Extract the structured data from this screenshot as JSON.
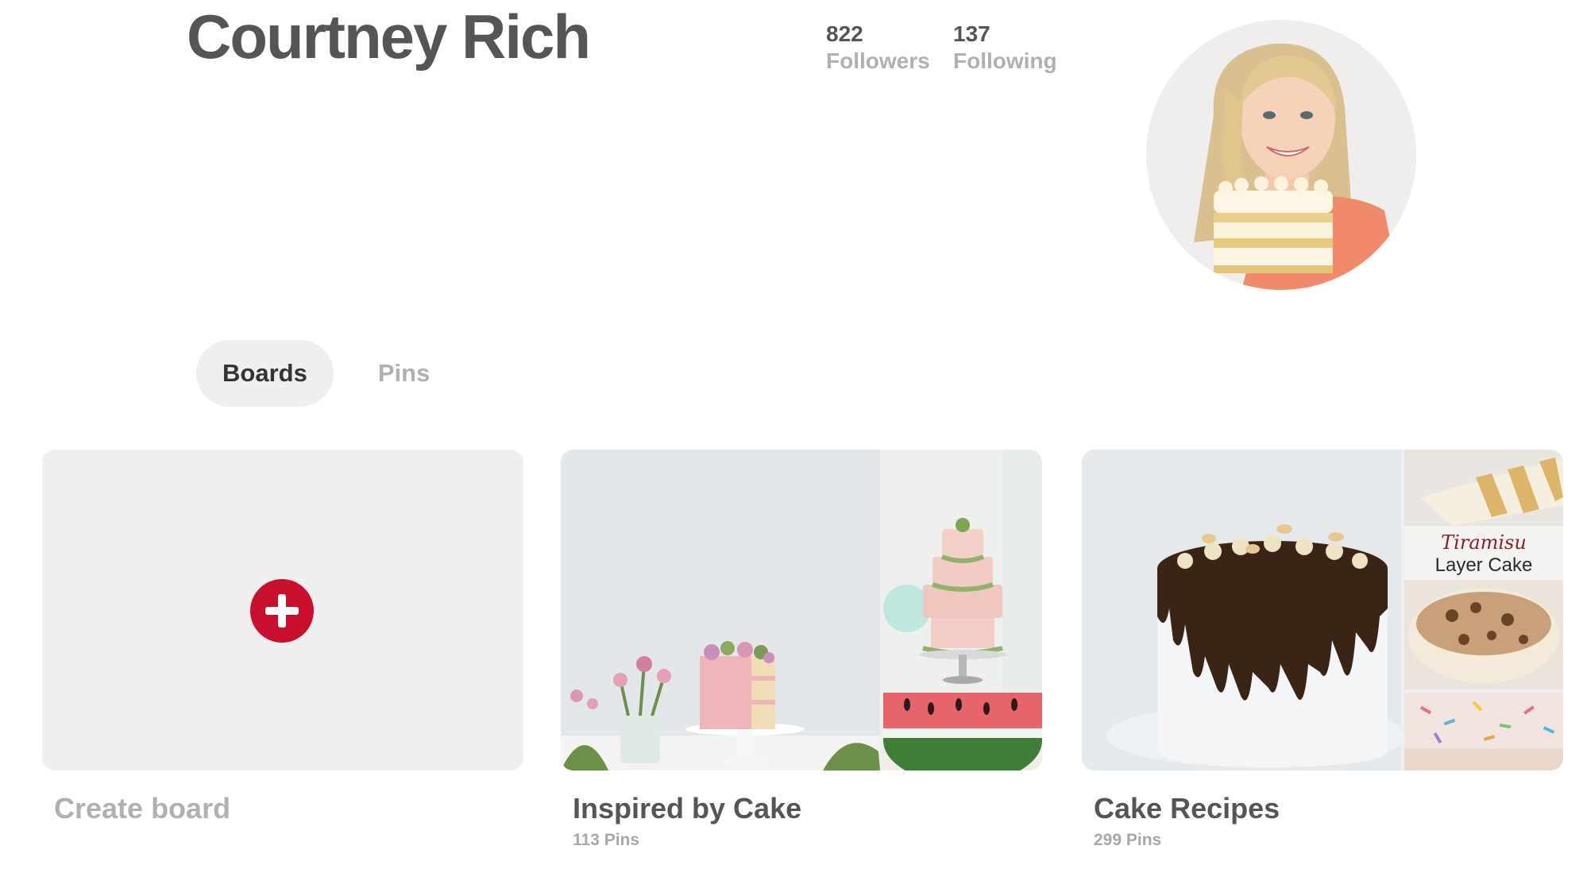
{
  "profile": {
    "name": "Courtney Rich",
    "followers_count": "822",
    "followers_label": "Followers",
    "following_count": "137",
    "following_label": "Following"
  },
  "tabs": [
    {
      "label": "Boards",
      "active": true
    },
    {
      "label": "Pins",
      "active": false
    }
  ],
  "boards": [
    {
      "title": "Create board",
      "count": ""
    },
    {
      "title": "Inspired by Cake",
      "count": "113 Pins"
    },
    {
      "title": "Cake Recipes",
      "count": "299 Pins"
    }
  ],
  "thumbnail_text": {
    "tiramisu_line1": "Tiramisu",
    "tiramisu_line2": "Layer Cake"
  },
  "colors": {
    "accent_red": "#c8102e",
    "tab_active_bg": "#efefef",
    "muted_text": "#b0b0b0"
  },
  "icons": {
    "create_board": "plus-circle-icon"
  }
}
